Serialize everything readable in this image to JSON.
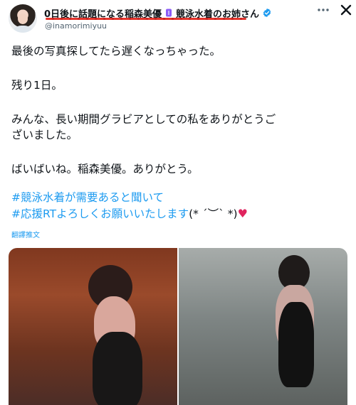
{
  "author": {
    "display_name": "0日後に話題になる稲森美優",
    "display_name_suffix": "競泳水着のお姉さん",
    "handle": "@inamorimiyuu",
    "verified": true
  },
  "icons": {
    "avatar": "profile-photo",
    "more": "more-icon",
    "platform": "x-logo-icon",
    "badge": "verified-icon",
    "heart": "heart-emoji"
  },
  "tweet": {
    "lines": [
      "最後の写真探してたら遅くなっちゃった。",
      "残り1日。",
      "みんな、長い期間グラビアとしての私をありがとうご",
      "ざいました。",
      "ばいばいね。稲森美優。ありがとう。"
    ],
    "hashtag_1": "#競泳水着が需要あると聞いて",
    "hashtag_2": "#応援RTよろしくお願いいたします",
    "kaomoji": "(* ´︶` *)",
    "heart": "♥"
  },
  "translate_label": "翻譯推文",
  "colors": {
    "link": "#1d9bf0",
    "text": "#0f1419",
    "muted": "#536471",
    "verified": "#1d9bf0",
    "underline": "#e2231a",
    "heart": "#e0245e"
  }
}
